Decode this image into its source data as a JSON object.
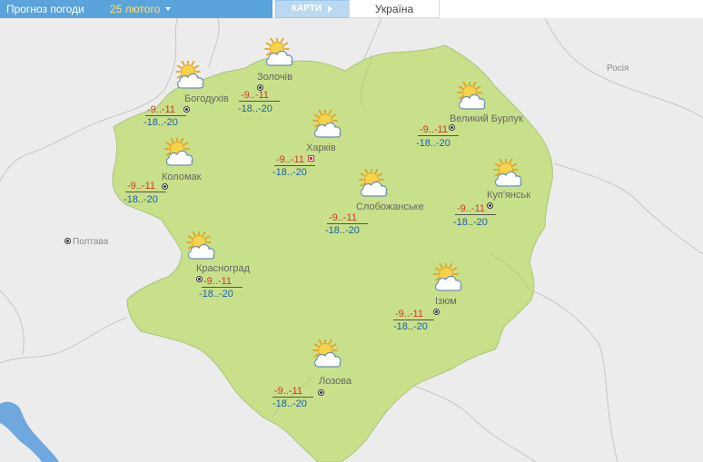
{
  "header": {
    "forecast_label": "Прогноз погоди",
    "date": "25 лютого",
    "maps_tab": "КАРТИ",
    "country_tab": "Україна"
  },
  "map": {
    "regions": [
      {
        "name": "Росія"
      },
      {
        "name": "Полтава"
      }
    ],
    "cities": [
      {
        "name": "Золочів",
        "day": "-9..-11",
        "night": "-18..-20",
        "icon": "sun-behind-cloud-icon"
      },
      {
        "name": "Богодухів",
        "day": "-9..-11",
        "night": "-18..-20",
        "icon": "sun-behind-cloud-icon"
      },
      {
        "name": "Харків",
        "day": "-9..-11",
        "night": "-18..-20",
        "icon": "sun-behind-cloud-icon",
        "capital": true
      },
      {
        "name": "Великий Бурлук",
        "day": "-9..-11",
        "night": "-18..-20",
        "icon": "sun-behind-cloud-icon"
      },
      {
        "name": "Коломак",
        "day": "-9..-11",
        "night": "-18..-20",
        "icon": "sun-behind-cloud-icon"
      },
      {
        "name": "Слобожанське",
        "day": "-9..-11",
        "night": "-18..-20",
        "icon": "sun-behind-cloud-icon"
      },
      {
        "name": "Куп'янськ",
        "day": "-9..-11",
        "night": "-18..-20",
        "icon": "sun-behind-cloud-icon"
      },
      {
        "name": "Красноград",
        "day": "-9..-11",
        "night": "-18..-20",
        "icon": "sun-behind-cloud-icon"
      },
      {
        "name": "Ізюм",
        "day": "-9..-11",
        "night": "-18..-20",
        "icon": "sun-behind-cloud-icon"
      },
      {
        "name": "Лозова",
        "day": "-9..-11",
        "night": "-18..-20",
        "icon": "sun-behind-cloud-icon"
      }
    ]
  },
  "colors": {
    "region_fill": "#c8e08a",
    "background": "#ececec",
    "water": "#6fa8dc",
    "day_temp": "#d0352d",
    "night_temp": "#1c5fa8",
    "header_bg": "#5aa3db"
  }
}
